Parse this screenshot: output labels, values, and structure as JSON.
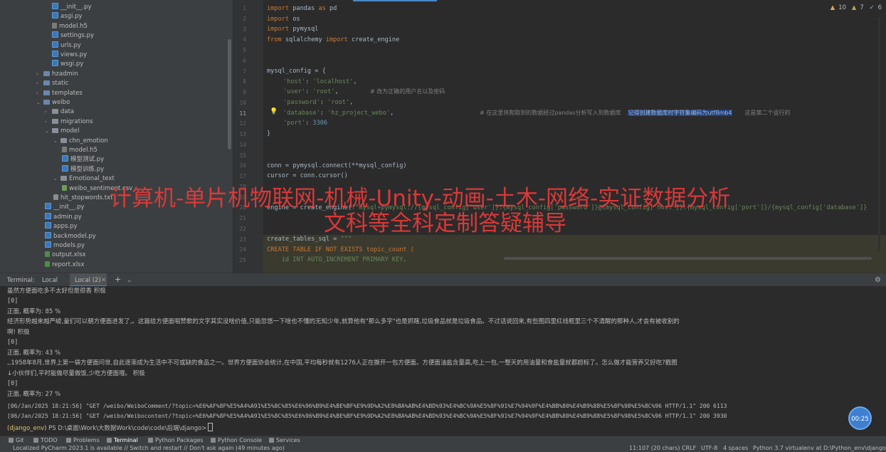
{
  "tree": {
    "items": [
      {
        "label": "__init__.py",
        "type": "py"
      },
      {
        "label": "asgi.py",
        "type": "py"
      },
      {
        "label": "model.h5",
        "type": "h5"
      },
      {
        "label": "settings.py",
        "type": "py"
      },
      {
        "label": "urls.py",
        "type": "py"
      },
      {
        "label": "views.py",
        "type": "py"
      },
      {
        "label": "wsgi.py",
        "type": "py"
      },
      {
        "label": "hzadmin",
        "type": "folder"
      },
      {
        "label": "static",
        "type": "folder"
      },
      {
        "label": "templates",
        "type": "folder"
      },
      {
        "label": "weibo",
        "type": "folder"
      },
      {
        "label": "data",
        "type": "folder"
      },
      {
        "label": "migrations",
        "type": "folder"
      },
      {
        "label": "model",
        "type": "folder"
      },
      {
        "label": "chn_emotion",
        "type": "folder"
      },
      {
        "label": "model.h5",
        "type": "h5"
      },
      {
        "label": "模型测试.py",
        "type": "py"
      },
      {
        "label": "模型训练.py",
        "type": "py"
      },
      {
        "label": "Emotional_text",
        "type": "folder"
      },
      {
        "label": "weibo_sentiment.csv",
        "type": "csv"
      },
      {
        "label": "hit_stopwords.txt",
        "type": "txt"
      },
      {
        "label": "__init__.py",
        "type": "py"
      },
      {
        "label": "admin.py",
        "type": "py"
      },
      {
        "label": "apps.py",
        "type": "py"
      },
      {
        "label": "backmodel.py",
        "type": "py"
      },
      {
        "label": "models.py",
        "type": "py"
      },
      {
        "label": "output.xlsx",
        "type": "xls"
      },
      {
        "label": "report.xlsx",
        "type": "xls"
      }
    ]
  },
  "editor": {
    "inspections": {
      "warnings": "10",
      "weak": "7",
      "typos": "6"
    },
    "line_numbers": [
      "1",
      "2",
      "3",
      "4",
      "5",
      "6",
      "7",
      "8",
      "9",
      "10",
      "11",
      "12",
      "13",
      "14",
      "15",
      "16",
      "17",
      "18",
      "19",
      "20",
      "21",
      "22",
      "23",
      "24",
      "25"
    ],
    "lines": {
      "l1_kw": "import",
      "l1_rest": " pandas ",
      "l1_as": "as",
      "l1_alias": " pd",
      "l2_kw": "import",
      "l2_rest": " os",
      "l3_kw": "import",
      "l3_rest": " pymysql",
      "l4_from": "from",
      "l4_mod": " sqlalchemy ",
      "l4_imp": "import",
      "l4_name": " create_engine",
      "l7": "mysql_config = {",
      "l8_key": "'host'",
      "l8_colon": ": ",
      "l8_val": "'localhost'",
      "l8_end": ",",
      "l9_key": "'user'",
      "l9_colon": ": ",
      "l9_val": "'root'",
      "l9_end": ",",
      "l9_cm": "# 改为正确的用户名以及密码",
      "l10_key": "'password'",
      "l10_colon": ": ",
      "l10_val": "'root'",
      "l10_end": ",",
      "l11_key": "'database'",
      "l11_colon": ": ",
      "l11_val": "'hz_project_webo'",
      "l11_end": ",",
      "l11_cm": "# 在这里将爬取到的数据经过pandas分析写入到数据库",
      "l11_hl": "记得创建数据库时字符集编码为utf8mb4",
      "l11_cm2": "这是第二个运行的",
      "l12_key": "'port'",
      "l12_colon": ": ",
      "l12_val": "3306",
      "l13": "}",
      "l16": "conn = pymysql.connect(**mysql_config)",
      "l17": "cursor = conn.cursor()",
      "l20_a": "engine = create_engine(",
      "l20_str": "f\"mysql+pymysql://{mysql_config['user']}:{mysql_config['password']}@{mysql_config['host']}:{mysql_config['port']}/{mysql_config['database']}",
      "l23_a": "create_tables_sql = ",
      "l23_str": "\"\"\"",
      "l24": "CREATE TABLE IF NOT EXISTS topic_count (",
      "l25": "    id INT AUTO_INCREMENT PRIMARY KEY,"
    }
  },
  "watermark": {
    "line1": "计算机-单片机物联网-机械-Unity-动画-土木-网络-实证数据分析",
    "line2": "文科等全科定制答疑辅导"
  },
  "terminal": {
    "title": "Terminal:",
    "tabs": [
      "Local",
      "Local (2)"
    ],
    "add": "+",
    "lines": [
      "虽然方便面吃多不太好但是很香 积极",
      "[0]",
      "正面, 概率为: 85 %",
      "经济形势越来越严峻,童们可以朝方便面进发了,。这篇给方便面唱赞歌的文字其实没啥价值,只能忽悠一下啥也不懂的无知少年,就算他有\"那么多字\"也是抓瞎,垃圾食品就是垃圾食品。不过话说回来,有些图四里红线框里三个不清醒的那种人,才会有被收割的",
      "啊! 积极",
      "[0]",
      "正面, 概率为: 43 %",
      ",,1958年8月,世界上第一袋方便面问世,自此逐渐成为生活中不可或缺的食品之一。世界方便面协会统计,在中国,平均每秒就有1276人正在撕开一包方便面。方便面油盐含量高,吃上一包,一整天的用油量和食盐量就都超标了。怎么做才能营养又好吃?戳图",
      "↓小伙伴们,平时能做尽量做饭,少吃方便面哦。 积极",
      "[0]",
      "正面, 概率为: 27 %",
      "[06/Jan/2025 18:21:56] \"GET /weibo/WeiboComment/?topic=%E6%AF%8F%E5%A4%A91%E5%8C%85%E6%96%B9%E4%BE%BF%E9%9D%A2%E8%BA%AB%E4%BD%93%E4%BC%9A%E5%8F%91%E7%94%9F%E4%BB%80%E4%B9%88%E5%8F%98%E5%8C%96 HTTP/1.1\" 200 6113",
      "[06/Jan/2025 18:21:56] \"GET /weibo/Weibocontent/?topic=%E6%AF%8F%E5%A4%A91%E5%8C%85%E6%96%B9%E4%BE%BF%E9%9D%A2%E8%BA%AB%E4%BD%93%E4%BC%9A%E5%8F%91%E7%94%9F%E4%BB%80%E4%B9%88%E5%8F%98%E5%8C%96 HTTP/1.1\" 200 3930"
    ],
    "prompt_env": "(django_env)",
    "prompt_path": " PS D:\\桌面\\Work\\大数据Work\\code\\code\\后端\\django>"
  },
  "timer": "00:25",
  "tool_tabs": [
    "Git",
    "TODO",
    "Problems",
    "Terminal",
    "Python Packages",
    "Python Console",
    "Services"
  ],
  "status": {
    "message": "Localized PyCharm 2023.1 is available // Switch and restart // Don't ask again (49 minutes ago)",
    "position": "11:107 (20 chars)",
    "line_sep": "CRLF",
    "encoding": "UTF-8",
    "indent": "4 spaces",
    "interpreter": "Python 3.7 virtualenv at D:\\Python_env\\django_env"
  }
}
